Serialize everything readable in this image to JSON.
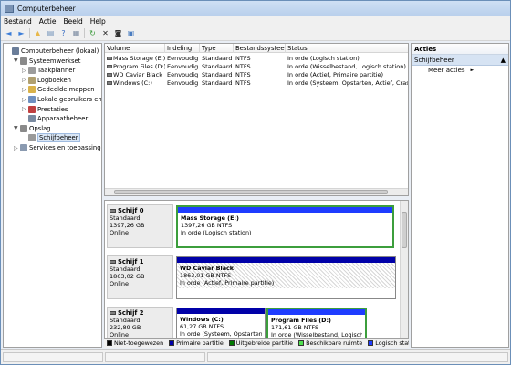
{
  "window": {
    "title": "Computerbeheer"
  },
  "menu": [
    "Bestand",
    "Actie",
    "Beeld",
    "Help"
  ],
  "toolbar": [
    {
      "icon": "back-arrow-icon",
      "color": "#3b7dd8",
      "glyph": "◄"
    },
    {
      "icon": "forward-arrow-icon",
      "color": "#3b7dd8",
      "glyph": "►"
    },
    {
      "icon": "folder-up-icon",
      "color": "#e8b84a",
      "glyph": "▲"
    },
    {
      "icon": "show-hide-tree-icon",
      "color": "#6e8fb8",
      "glyph": "▤"
    },
    {
      "icon": "help-icon",
      "color": "#3b6fc4",
      "glyph": "?"
    },
    {
      "icon": "properties-icon",
      "color": "#7a8aa0",
      "glyph": "▦"
    },
    {
      "icon": "refresh-icon",
      "color": "#3a9a3a",
      "glyph": "↻"
    },
    {
      "icon": "delete-icon",
      "color": "#222222",
      "glyph": "✕"
    },
    {
      "icon": "check-disk-icon",
      "color": "#333333",
      "glyph": "◙"
    },
    {
      "icon": "export-list-icon",
      "color": "#4a7cc0",
      "glyph": "▣"
    }
  ],
  "tree": [
    {
      "label": "Computerbeheer (lokaal)",
      "icon": "computer-management-icon",
      "color": "#6a7d99",
      "level": 0,
      "exp": ""
    },
    {
      "label": "Systeemwerkset",
      "icon": "system-tools-icon",
      "color": "#8a8a8a",
      "level": 1,
      "exp": "▼"
    },
    {
      "label": "Taakplanner",
      "icon": "task-scheduler-icon",
      "color": "#9c9c9c",
      "level": 2,
      "exp": "▷"
    },
    {
      "label": "Logboeken",
      "icon": "event-viewer-icon",
      "color": "#b0a070",
      "level": 2,
      "exp": "▷"
    },
    {
      "label": "Gedeelde mappen",
      "icon": "shared-folders-icon",
      "color": "#d9b24a",
      "level": 2,
      "exp": "▷"
    },
    {
      "label": "Lokale gebruikers en groepen",
      "icon": "users-icon",
      "color": "#6f90c0",
      "level": 2,
      "exp": "▷"
    },
    {
      "label": "Prestaties",
      "icon": "performance-icon",
      "color": "#c04040",
      "level": 2,
      "exp": "▷"
    },
    {
      "label": "Apparaatbeheer",
      "icon": "device-manager-icon",
      "color": "#7a8aa0",
      "level": 2,
      "exp": ""
    },
    {
      "label": "Opslag",
      "icon": "storage-icon",
      "color": "#8a8a8a",
      "level": 1,
      "exp": "▼"
    },
    {
      "label": "Schijfbeheer",
      "icon": "disk-management-icon",
      "color": "#9a9a9a",
      "level": 2,
      "exp": "",
      "selected": true
    },
    {
      "label": "Services en toepassingen",
      "icon": "services-icon",
      "color": "#8a9ab0",
      "level": 1,
      "exp": "▷"
    }
  ],
  "volumes": {
    "columns": [
      "Volume",
      "Indeling",
      "Type",
      "Bestandssysteem",
      "Status"
    ],
    "rows": [
      [
        "Mass Storage (E:)",
        "Eenvoudig",
        "Standaard",
        "NTFS",
        "In orde (Logisch station)"
      ],
      [
        "Program Files (D:)",
        "Eenvoudig",
        "Standaard",
        "NTFS",
        "In orde (Wisselbestand, Logisch station)"
      ],
      [
        "WD Caviar Black",
        "Eenvoudig",
        "Standaard",
        "NTFS",
        "In orde (Actief, Primaire partitie)"
      ],
      [
        "Windows (C:)",
        "Eenvoudig",
        "Standaard",
        "NTFS",
        "In orde (Systeem, Opstarten, Actief, Crashdump, Primaire partitie)"
      ]
    ]
  },
  "disks": [
    {
      "name": "Schijf 0",
      "type": "Standaard",
      "size": "1397,26 GB",
      "state": "Online",
      "partitions": [
        {
          "name": "Mass Storage  (E:)",
          "size": "1397,26 GB NTFS",
          "status": "In orde (Logisch station)",
          "kind": "logical"
        }
      ]
    },
    {
      "name": "Schijf 1",
      "type": "Standaard",
      "size": "1863,02 GB",
      "state": "Online",
      "partitions": [
        {
          "name": "WD Caviar Black",
          "size": "1863,01 GB NTFS",
          "status": "In orde (Actief, Primaire partitie)",
          "kind": "primary-active"
        }
      ]
    },
    {
      "name": "Schijf 2",
      "type": "Standaard",
      "size": "232,89 GB",
      "state": "Online",
      "partitions": [
        {
          "name": "Windows  (C:)",
          "size": "61,27 GB NTFS",
          "status": "In orde (Systeem, Opstarten, A",
          "kind": "primary"
        },
        {
          "name": "Program Files  (D:)",
          "size": "171,61 GB NTFS",
          "status": "In orde (Wisselbestand, Logisch s",
          "kind": "logical"
        }
      ]
    }
  ],
  "legend": [
    {
      "label": "Niet-toegewezen",
      "color": "#000000"
    },
    {
      "label": "Primaire partitie",
      "color": "#0000a8"
    },
    {
      "label": "Uitgebreide partitie",
      "color": "#007a00"
    },
    {
      "label": "Beschikbare ruimte",
      "color": "#4fe04f"
    },
    {
      "label": "Logisch station",
      "color": "#1e3cff"
    }
  ],
  "actions": {
    "header": "Acties",
    "section": "Schijfbeheer",
    "items": [
      "Meer acties"
    ]
  }
}
